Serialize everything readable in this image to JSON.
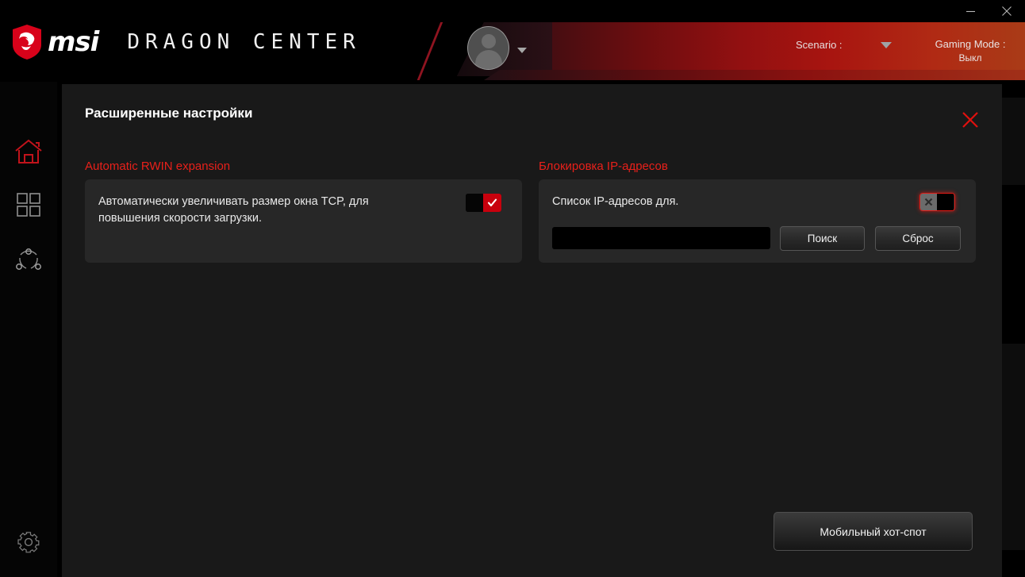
{
  "window": {
    "minimize_label": "–",
    "close_label": "×"
  },
  "header": {
    "brand": "msi",
    "product": "DRAGON CENTER",
    "shield_icon": "msi-dragon-shield-icon",
    "avatar_icon": "user-avatar-icon",
    "avatar_caret_icon": "chevron-down-icon",
    "scenario_label": "Scenario :",
    "scenario_caret_icon": "chevron-down-icon",
    "gaming_mode_label": "Gaming Mode :",
    "gaming_mode_value": "Выкл",
    "accent_color": "#c8000d"
  },
  "sidebar": {
    "items": [
      {
        "name": "home",
        "icon": "home-icon",
        "active": true
      },
      {
        "name": "apps",
        "icon": "grid-apps-icon",
        "active": false
      },
      {
        "name": "network",
        "icon": "network-share-icon",
        "active": false
      }
    ],
    "settings": {
      "name": "settings",
      "icon": "gear-icon"
    }
  },
  "dialog": {
    "title": "Расширенные настройки",
    "close_icon": "close-x-icon",
    "sections": [
      {
        "key": "rwin",
        "title": "Automatic RWIN expansion",
        "description": "Автоматически увеличивать размер окна TCP, для повышения скорости загрузки.",
        "toggle_state": "on",
        "toggle_on_icon": "check-icon"
      },
      {
        "key": "ipblock",
        "title": "Блокировка IP-адресов",
        "description": "Список IP-адресов для.",
        "toggle_state": "off",
        "toggle_off_icon": "x-icon",
        "input": {
          "value": "",
          "placeholder": ""
        },
        "search_button": "Поиск",
        "reset_button": "Сброс"
      }
    ],
    "hotspot_button": "Мобильный хот-спот"
  }
}
